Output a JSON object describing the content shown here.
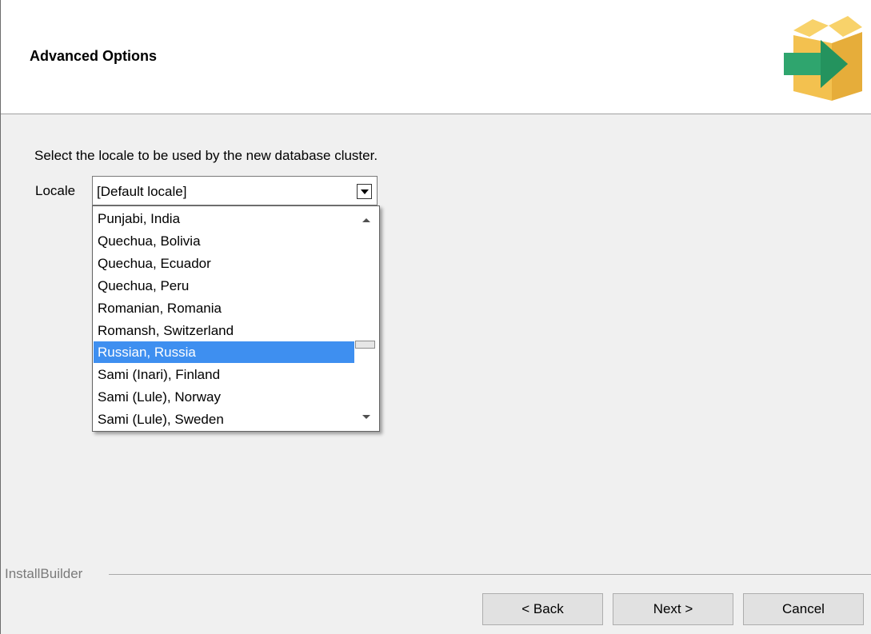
{
  "header": {
    "title": "Advanced Options",
    "logo_icon": "installer-box-arrow-icon"
  },
  "colors": {
    "header_bg": "#ffffff",
    "body_bg": "#f0f0f0",
    "selection": "#3e8ff0",
    "logo_box": "#f3c14f",
    "logo_arrow": "#2fa56e"
  },
  "main": {
    "instruction": "Select the locale to be used by the new database cluster.",
    "locale_label": "Locale",
    "locale_value": "[Default locale]",
    "locale_options": [
      "Punjabi, India",
      "Quechua, Bolivia",
      "Quechua, Ecuador",
      "Quechua, Peru",
      "Romanian, Romania",
      "Romansh, Switzerland",
      "Russian, Russia",
      "Sami (Inari), Finland",
      "Sami (Lule), Norway",
      "Sami (Lule), Sweden"
    ],
    "highlighted_option": "Russian, Russia"
  },
  "footer": {
    "brand": "InstallBuilder",
    "back_label": "< Back",
    "next_label": "Next >",
    "cancel_label": "Cancel"
  }
}
